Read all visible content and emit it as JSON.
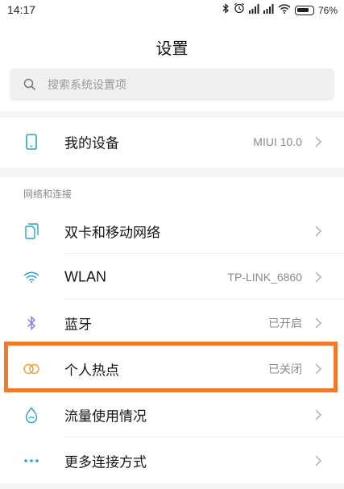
{
  "status_bar": {
    "time": "14:17",
    "battery_percent": "76%",
    "icons": [
      "bluetooth-icon",
      "alarm-icon",
      "signal-icon",
      "signal-icon",
      "wifi-icon",
      "battery-icon"
    ]
  },
  "header": {
    "title": "设置"
  },
  "search": {
    "placeholder": "搜索系统设置项"
  },
  "my_device": {
    "label": "我的设备",
    "value": "MIUI 10.0"
  },
  "network_section": {
    "heading": "网络和连接",
    "items": [
      {
        "label": "双卡和移动网络",
        "value": "",
        "icon": "dual-sim-icon"
      },
      {
        "label": "WLAN",
        "value": "TP-LINK_6860",
        "icon": "wifi-icon"
      },
      {
        "label": "蓝牙",
        "value": "已开启",
        "icon": "bluetooth-icon"
      },
      {
        "label": "个人热点",
        "value": "已关闭",
        "icon": "hotspot-icon"
      },
      {
        "label": "流量使用情况",
        "value": "",
        "icon": "data-usage-icon"
      },
      {
        "label": "更多连接方式",
        "value": "",
        "icon": "more-icon"
      }
    ]
  },
  "colors": {
    "accent": "#2a9fd6",
    "highlight_border": "#f07a2c",
    "hotspot_icon": "#e8a33a"
  }
}
